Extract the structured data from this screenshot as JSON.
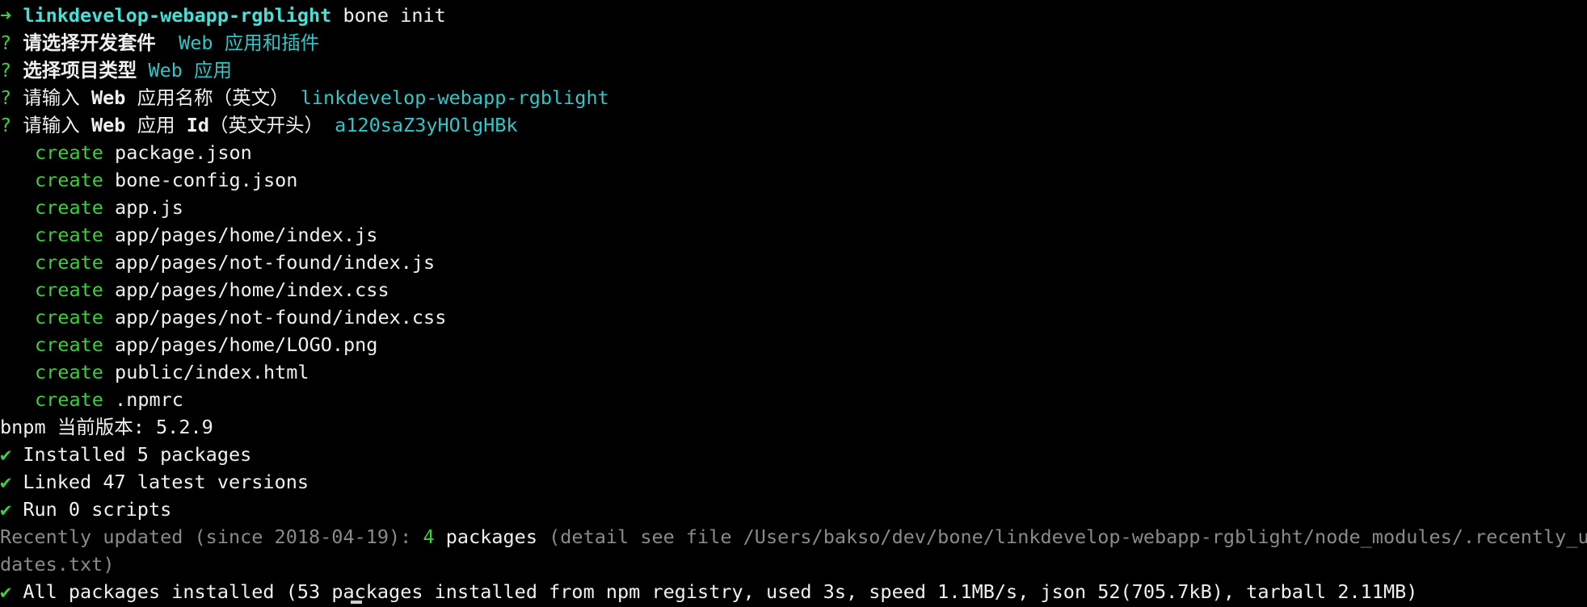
{
  "prompt": {
    "arrow": "➜",
    "directory": "linkdevelop-webapp-rgblight",
    "command": "bone init"
  },
  "questions": [
    {
      "mark": "?",
      "question": "请选择开发套件",
      "answer": "Web 应用和插件"
    },
    {
      "mark": "?",
      "question": "选择项目类型",
      "answer": "Web 应用"
    },
    {
      "mark": "?",
      "question_pre": "请输入 ",
      "question_bold": "Web",
      "question_post": " 应用名称（英文）",
      "answer": "linkdevelop-webapp-rgblight"
    },
    {
      "mark": "?",
      "question_pre": "请输入 ",
      "question_bold": "Web",
      "question_mid": " 应用 ",
      "question_bold2": "Id",
      "question_post": "（英文开头）",
      "answer": "a120saZ3yHOlgHBk"
    }
  ],
  "created_files": [
    {
      "action": "create",
      "path": "package.json"
    },
    {
      "action": "create",
      "path": "bone-config.json"
    },
    {
      "action": "create",
      "path": "app.js"
    },
    {
      "action": "create",
      "path": "app/pages/home/index.js"
    },
    {
      "action": "create",
      "path": "app/pages/not-found/index.js"
    },
    {
      "action": "create",
      "path": "app/pages/home/index.css"
    },
    {
      "action": "create",
      "path": "app/pages/not-found/index.css"
    },
    {
      "action": "create",
      "path": "app/pages/home/LOGO.png"
    },
    {
      "action": "create",
      "path": "public/index.html"
    },
    {
      "action": "create",
      "path": ".npmrc"
    }
  ],
  "bnpm_version": "bnpm 当前版本: 5.2.9",
  "results": [
    {
      "check": "✔",
      "text": "Installed 5 packages"
    },
    {
      "check": "✔",
      "text": "Linked 47 latest versions"
    },
    {
      "check": "✔",
      "text": "Run 0 scripts"
    }
  ],
  "recent": {
    "prefix": "Recently updated (since 2018-04-19): ",
    "count": "4",
    "word": " packages",
    "detail_line1": " (detail see file /Users/bakso/dev/bone/linkdevelop-webapp-rgblight/node_modules/.recently_up",
    "detail_line2": "dates.txt)"
  },
  "final": {
    "check": "✔",
    "text": "All packages installed (53 packages installed from npm registry, used 3s, speed 1.1MB/s, json 52(705.7kB), tarball 2.11MB)"
  },
  "colors": {
    "background": "#000000",
    "green": "#3ad13a",
    "cyan": "#2fc7c7",
    "dim": "#8a8a8a",
    "text": "#ececec"
  }
}
